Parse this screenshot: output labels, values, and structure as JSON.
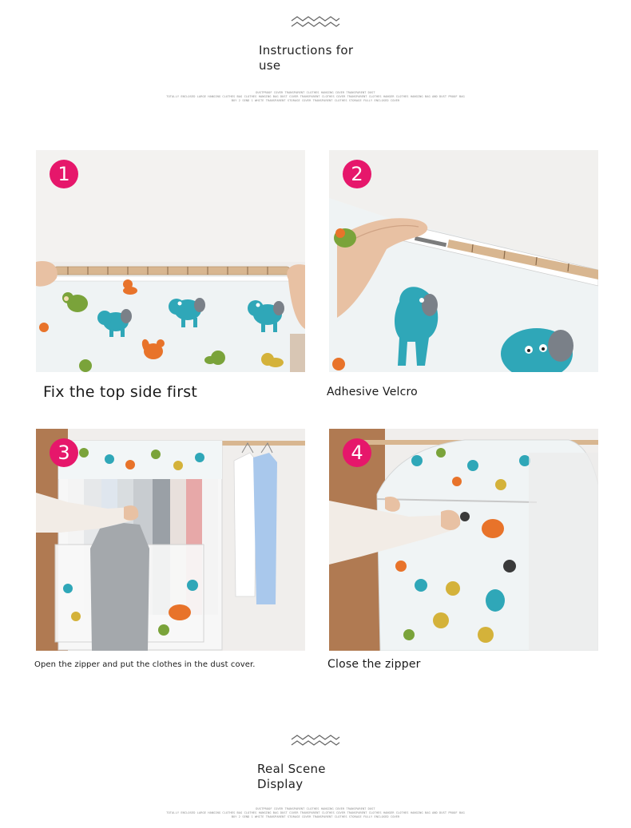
{
  "header": {
    "decoration_icon": "zigzag-wave-icon",
    "title": "Instructions for\nuse",
    "fine_print": [
      "DUSTPROOF COVER  TRANSPARENT CLOTHES HANGING COVER  TRANSPARENT DUST",
      "TOTALLY ENCLOSED LARGE HANGING CLOTHES BAG CLOTHES HANGING BAG DUST COVER TRANSPARENT CLOTHES COVER TRANSPARENT CLOTHES HANGER CLOTHES HANGING BAG AND DUST PROOF BAG",
      "BUY 2 SEND 1 WHITE TRANSPARENT STORAGE COVER TRANSPARENT CLOTHES STORAGE FULLY ENCLOSED COVER"
    ]
  },
  "steps": [
    {
      "number": "1",
      "caption": "Fix the top side first"
    },
    {
      "number": "2",
      "caption": "Adhesive Velcro"
    },
    {
      "number": "3",
      "caption": "Open the zipper and put the clothes in the dust cover."
    },
    {
      "number": "4",
      "caption": "Close the zipper"
    }
  ],
  "footer": {
    "decoration_icon": "zigzag-wave-icon",
    "title": "Real Scene\nDisplay",
    "fine_print": [
      "DUSTPROOF COVER  TRANSPARENT CLOTHES HANGING COVER  TRANSPARENT DUST",
      "TOTALLY ENCLOSED LARGE HANGING CLOTHES BAG CLOTHES HANGING BAG DUST COVER TRANSPARENT CLOTHES COVER TRANSPARENT CLOTHES HANGER CLOTHES HANGING BAG AND DUST PROOF BAG",
      "BUY 2 SEND 1 WHITE TRANSPARENT STORAGE COVER TRANSPARENT CLOTHES STORAGE FULLY ENCLOSED COVER"
    ]
  },
  "colors": {
    "badge": "#e6176b",
    "elephant": "#2fa7b8",
    "monkey": "#7aa33a",
    "squirrel": "#e8732a",
    "wood": "#d8b690"
  }
}
